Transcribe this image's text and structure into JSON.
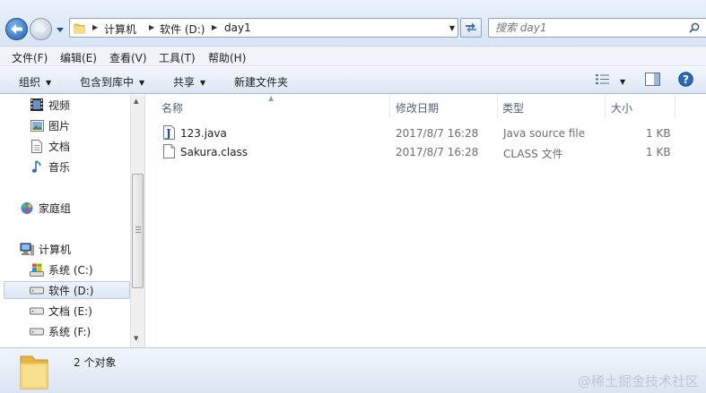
{
  "address": {
    "breadcrumbs": [
      "计算机",
      "软件 (D:)",
      "day1"
    ]
  },
  "search": {
    "placeholder": "搜索 day1"
  },
  "menu": [
    "文件(F)",
    "编辑(E)",
    "查看(V)",
    "工具(T)",
    "帮助(H)"
  ],
  "toolbar": {
    "organize": "组织",
    "include_library": "包含到库中",
    "share": "共享",
    "new_folder": "新建文件夹"
  },
  "nav": {
    "videos": "视频",
    "pictures": "图片",
    "documents": "文档",
    "music": "音乐",
    "homegroup": "家庭组",
    "computer": "计算机",
    "drive_c": "系统 (C:)",
    "drive_d": "软件 (D:)",
    "drive_e": "文档 (E:)",
    "drive_f": "系统 (F:)"
  },
  "columns": {
    "name": "名称",
    "modified": "修改日期",
    "type": "类型",
    "size": "大小"
  },
  "files": [
    {
      "name": "123.java",
      "modified": "2017/8/7 16:28",
      "type": "Java source file",
      "size": "1 KB",
      "icon": "java-file-icon"
    },
    {
      "name": "Sakura.class",
      "modified": "2017/8/7 16:28",
      "type": "CLASS 文件",
      "size": "1 KB",
      "icon": "generic-file-icon"
    }
  ],
  "details": {
    "count": "2 个对象"
  },
  "watermark": "@稀土掘金技术社区"
}
